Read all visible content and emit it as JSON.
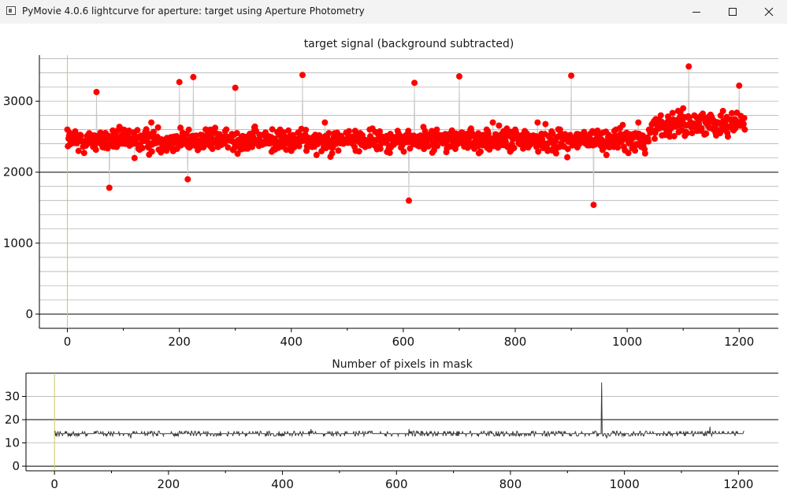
{
  "window": {
    "title": "PyMovie 4.0.6 lightcurve for aperture: target using Aperture Photometry",
    "icon": "app-window-icon",
    "controls": [
      "minimize-icon",
      "maximize-icon",
      "close-icon"
    ]
  },
  "chart_data": [
    {
      "type": "scatter",
      "title": "target signal (background subtracted)",
      "xlabel": "",
      "ylabel": "",
      "xlim": [
        -50,
        1270
      ],
      "ylim": [
        -200,
        3650
      ],
      "xticks": [
        "0",
        "200",
        "400",
        "600",
        "800",
        "1000",
        "1200"
      ],
      "yticks": [
        "0",
        "1000",
        "2000",
        "3000"
      ],
      "grid": true,
      "colors": {
        "points": "#ff0000",
        "line": "#c8c8c8",
        "marker_line": "#c8c860"
      },
      "series": [
        {
          "values_summary": "≈1210 frames, signal mostly between 1800 and 3300, centered near 2500",
          "x": [
            0,
            20,
            40,
            52,
            60,
            75,
            100,
            120,
            150,
            190,
            200,
            215,
            225,
            240,
            260,
            280,
            300,
            320,
            350,
            380,
            400,
            420,
            440,
            460,
            480,
            500,
            520,
            540,
            560,
            580,
            600,
            610,
            620,
            640,
            660,
            680,
            700,
            720,
            740,
            760,
            780,
            800,
            820,
            840,
            860,
            880,
            900,
            920,
            940,
            960,
            980,
            1000,
            1020,
            1040,
            1060,
            1080,
            1100,
            1110,
            1120,
            1140,
            1160,
            1180,
            1200,
            1210
          ],
          "y": [
            2600,
            2300,
            2500,
            3130,
            2400,
            1780,
            2600,
            2200,
            2700,
            2500,
            3270,
            1900,
            3340,
            2450,
            2600,
            2500,
            3190,
            2500,
            2400,
            2600,
            2300,
            3370,
            2500,
            2700,
            2400,
            2550,
            2500,
            2600,
            2400,
            2500,
            2500,
            1600,
            3260,
            2400,
            2600,
            2500,
            3350,
            2600,
            2500,
            2700,
            2500,
            2600,
            2400,
            2700,
            2500,
            2600,
            3360,
            2500,
            1540,
            2400,
            2600,
            2500,
            2700,
            2600,
            2800,
            2700,
            2900,
            3490,
            2800,
            2700,
            2600,
            2500,
            3220,
            2600
          ]
        }
      ]
    },
    {
      "type": "line",
      "title": "Number of pixels in mask",
      "xlabel": "",
      "ylabel": "",
      "xlim": [
        -50,
        1270
      ],
      "ylim": [
        -2,
        40
      ],
      "xticks": [
        "0",
        "200",
        "400",
        "600",
        "800",
        "1000",
        "1200"
      ],
      "yticks": [
        "0",
        "10",
        "20",
        "30"
      ],
      "grid": true,
      "colors": {
        "line": "#3c3c3c",
        "marker_line": "#c8c860"
      },
      "series": [
        {
          "values_summary": "mask pixel count ≈9–19 around 14, single spike to 36 near frame 960",
          "x": [
            0,
            100,
            200,
            300,
            400,
            450,
            500,
            600,
            700,
            800,
            900,
            960,
            1000,
            1100,
            1150,
            1210
          ],
          "y": [
            15,
            14,
            14,
            14,
            14,
            16,
            14,
            14,
            15,
            14,
            14,
            36,
            14,
            14,
            17,
            15
          ]
        }
      ]
    }
  ]
}
